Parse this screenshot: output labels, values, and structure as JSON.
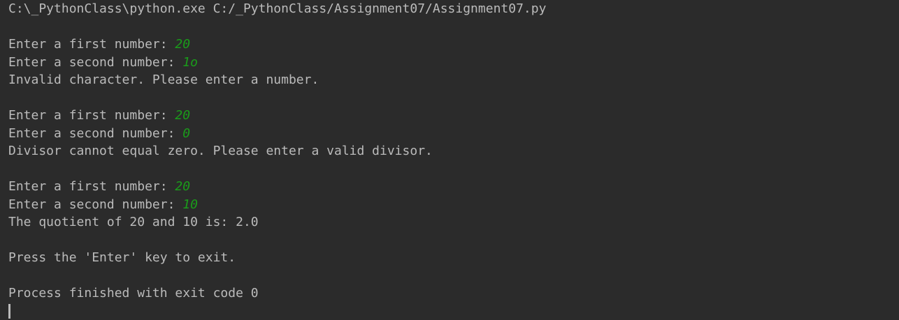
{
  "command": "C:\\_PythonClass\\python.exe C:/_PythonClass/Assignment07/Assignment07.py",
  "attempts": [
    {
      "first_prompt": "Enter a first number: ",
      "first_input": "20",
      "second_prompt": "Enter a second number: ",
      "second_input": "1o",
      "result": "Invalid character. Please enter a number."
    },
    {
      "first_prompt": "Enter a first number: ",
      "first_input": "20",
      "second_prompt": "Enter a second number: ",
      "second_input": "0",
      "result": "Divisor cannot equal zero. Please enter a valid divisor."
    },
    {
      "first_prompt": "Enter a first number: ",
      "first_input": "20",
      "second_prompt": "Enter a second number: ",
      "second_input": "10",
      "result": "The quotient of 20 and 10 is: 2.0"
    }
  ],
  "exit_prompt": "Press the 'Enter' key to exit.",
  "process_status": "Process finished with exit code 0",
  "colors": {
    "background": "#2b2b2b",
    "text": "#bbbbbb",
    "user_input": "#1a9c1a"
  }
}
